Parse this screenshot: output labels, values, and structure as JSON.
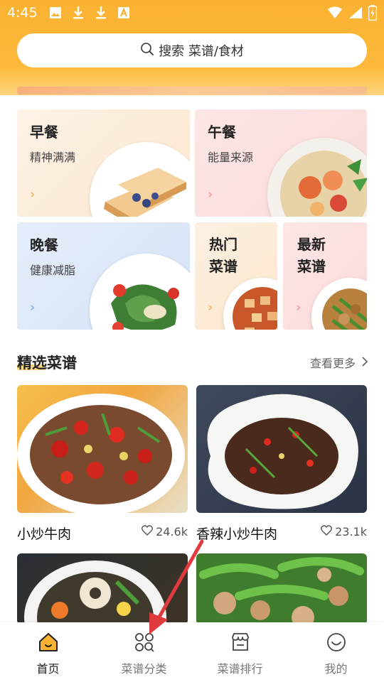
{
  "status_bar": {
    "time": "4:45"
  },
  "search": {
    "label": "搜索 菜谱/食材"
  },
  "categories": [
    {
      "title": "早餐",
      "subtitle": "精神满满"
    },
    {
      "title": "午餐",
      "subtitle": "能量来源"
    },
    {
      "title": "晚餐",
      "subtitle": "健康减脂"
    },
    {
      "title_line1": "热门",
      "title_line2": "菜谱"
    },
    {
      "title_line1": "最新",
      "title_line2": "菜谱"
    }
  ],
  "featured": {
    "title": "精选菜谱",
    "see_more": "查看更多"
  },
  "recipes": [
    {
      "name": "小炒牛肉",
      "likes": "24.6k"
    },
    {
      "name": "香辣小炒牛肉",
      "likes": "23.1k"
    }
  ],
  "bottom_nav": [
    {
      "label": "首页",
      "icon": "home-icon",
      "active": true
    },
    {
      "label": "菜谱分类",
      "icon": "category-grid-icon",
      "active": false
    },
    {
      "label": "菜谱排行",
      "icon": "store-ranking-icon",
      "active": false
    },
    {
      "label": "我的",
      "icon": "smile-profile-icon",
      "active": false
    }
  ],
  "colors": {
    "accent": "#fbb232",
    "annotation_arrow": "#e0393e"
  }
}
